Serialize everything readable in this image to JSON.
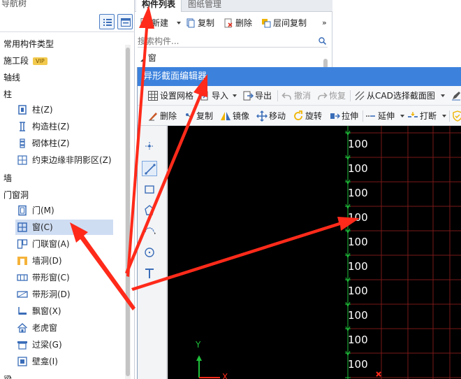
{
  "nav": {
    "title": "导航树",
    "categories": [
      {
        "label": "常用构件类型",
        "badge": ""
      },
      {
        "label": "施工段",
        "badge": "VIP"
      },
      {
        "label": "轴线",
        "badge": ""
      },
      {
        "label": "柱",
        "badge": ""
      },
      {
        "label": "墙",
        "badge": ""
      },
      {
        "label": "门窗洞",
        "badge": ""
      },
      {
        "label": "梁",
        "badge": ""
      }
    ],
    "column_items": [
      "柱(Z)",
      "构造柱(Z)",
      "砌体柱(Z)",
      "约束边缘非阴影区(Z)"
    ],
    "opening_items": [
      "门(M)",
      "窗(C)",
      "门联窗(A)",
      "墙洞(D)",
      "带形窗(C)",
      "带形洞(D)",
      "飘窗(X)",
      "老虎窗",
      "过梁(G)",
      "壁龛(I)"
    ],
    "selected": "窗(C)"
  },
  "complist": {
    "tabs": [
      "构件列表",
      "图纸管理"
    ],
    "toolbar": [
      "新建",
      "复制",
      "删除",
      "层间复制"
    ],
    "more": "»",
    "search_placeholder": "搜索构件...",
    "row": "窗"
  },
  "editor": {
    "title": "异形截面编辑器",
    "toolbar1": [
      "设置网格",
      "导入",
      "导出",
      "撤消",
      "恢复",
      "从CAD选择截面图"
    ],
    "toolbar2": [
      "删除",
      "复制",
      "镜像",
      "移动",
      "旋转",
      "拉伸",
      "延伸",
      "打断"
    ],
    "grid_labels": [
      "100",
      "100",
      "100",
      "100",
      "100",
      "100",
      "100",
      "100",
      "100",
      "100"
    ],
    "axis_y": "Y",
    "axis_x": "X"
  },
  "colors": {
    "accent": "#3c82dd",
    "selection": "#cfddf3",
    "annotation": "#ff2a1a",
    "grid": "#8a1a1a",
    "grid_green": "#1fbf3a"
  }
}
